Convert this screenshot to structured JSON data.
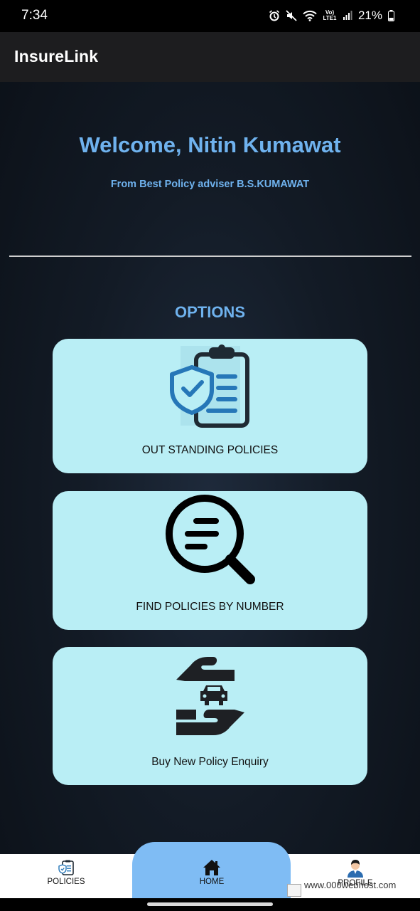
{
  "status_bar": {
    "time": "7:34",
    "network_label": "Vo) LTE1",
    "battery": "21%",
    "icons": [
      "alarm-icon",
      "mute-icon",
      "wifi-icon",
      "signal-icon",
      "battery-icon"
    ]
  },
  "app_bar": {
    "title": "InsureLink"
  },
  "header": {
    "welcome": "Welcome, Nitin Kumawat",
    "adviser": "From Best Policy adviser B.S.KUMAWAT"
  },
  "options": {
    "heading": "OPTIONS",
    "cards": [
      {
        "label": "OUT STANDING POLICIES",
        "icon": "clipboard-shield-icon"
      },
      {
        "label": "FIND POLICIES BY NUMBER",
        "icon": "magnifier-icon"
      },
      {
        "label": "Buy New Policy Enquiry",
        "icon": "hands-car-icon"
      }
    ]
  },
  "bottom_nav": {
    "items": [
      {
        "label": "POLICIES",
        "icon": "policies-icon"
      },
      {
        "label": "HOME",
        "icon": "home-icon",
        "active": true
      },
      {
        "label": "PROFILE",
        "icon": "profile-icon"
      }
    ]
  },
  "watermark": {
    "text": "www.000webhost.com"
  },
  "colors": {
    "accent": "#6fb2ee",
    "card_bg": "#b9eef5",
    "nav_active": "#7fbcf4",
    "app_bar": "#1d1d1f"
  }
}
